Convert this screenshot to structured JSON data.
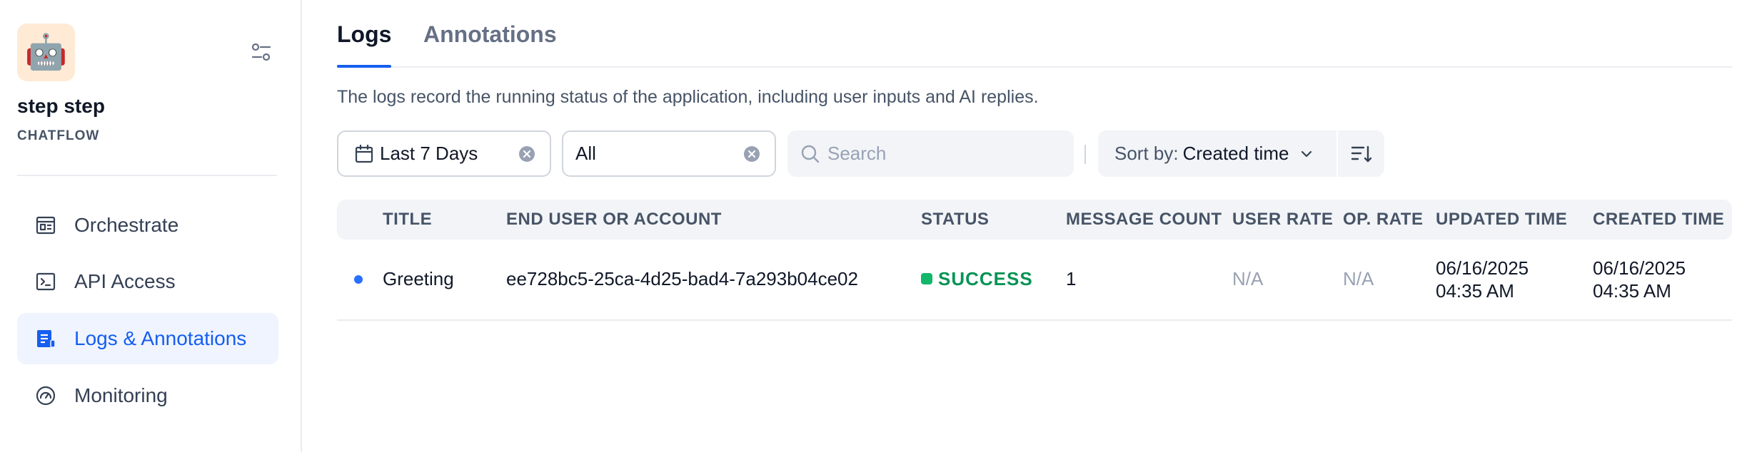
{
  "app": {
    "name": "step step",
    "type": "CHATFLOW",
    "icon": "robot-face-icon",
    "icon_glyph": "🤖"
  },
  "sidebar": {
    "items": [
      {
        "label": "Orchestrate",
        "icon": "layout-window-icon",
        "active": false
      },
      {
        "label": "API Access",
        "icon": "terminal-icon",
        "active": false
      },
      {
        "label": "Logs & Annotations",
        "icon": "file-list-icon",
        "active": true
      },
      {
        "label": "Monitoring",
        "icon": "dashboard-gauge-icon",
        "active": false
      }
    ]
  },
  "tabs": [
    {
      "label": "Logs",
      "active": true
    },
    {
      "label": "Annotations",
      "active": false
    }
  ],
  "description": "The logs record the running status of the application, including user inputs and AI replies.",
  "filters": {
    "period": "Last 7 Days",
    "annotation_status": "All",
    "search_placeholder": "Search",
    "sort_prefix": "Sort by:",
    "sort_value": "Created time"
  },
  "table": {
    "headers": [
      "TITLE",
      "END USER OR ACCOUNT",
      "STATUS",
      "MESSAGE COUNT",
      "USER RATE",
      "OP. RATE",
      "UPDATED TIME",
      "CREATED TIME"
    ],
    "rows": [
      {
        "title": "Greeting",
        "end_user": "ee728bc5-25ca-4d25-bad4-7a293b04ce02",
        "status": "SUCCESS",
        "message_count": "1",
        "user_rate": "N/A",
        "op_rate": "N/A",
        "updated_date": "06/16/2025",
        "updated_time": "04:35 AM",
        "created_date": "06/16/2025",
        "created_time": "04:35 AM",
        "unread": true
      }
    ]
  },
  "colors": {
    "accent": "#155eef",
    "active_bg": "#eff4ff",
    "success": "#12b76a",
    "app_icon_bg": "#ffead5"
  }
}
